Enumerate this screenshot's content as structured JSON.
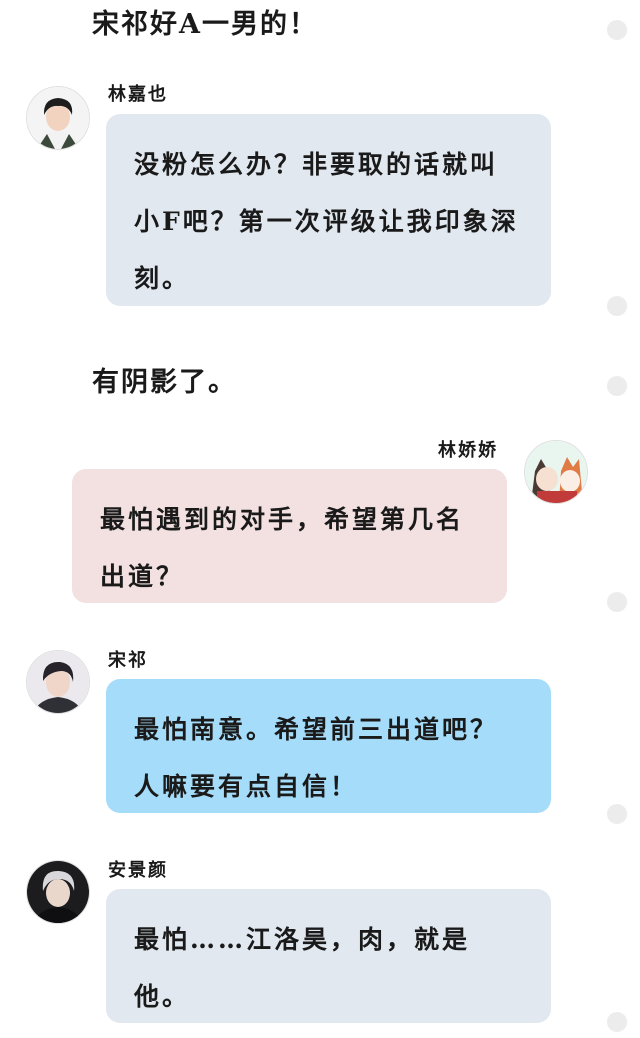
{
  "messages": [
    {
      "type": "narration",
      "text": "宋祁好A一男的！"
    },
    {
      "type": "chat",
      "side": "left",
      "sender": "林嘉也",
      "text": "没粉怎么办？非要取的话就叫小F吧？第一次评级让我印象深刻。",
      "avatar_icon": "avatar-boy-icon"
    },
    {
      "type": "narration",
      "text": "有阴影了。"
    },
    {
      "type": "chat",
      "side": "right",
      "sender": "林娇娇",
      "text": "最怕遇到的对手，希望第几名出道？",
      "avatar_icon": "avatar-cartoon-cats-icon"
    },
    {
      "type": "chat",
      "side": "left",
      "sender": "宋祁",
      "text": "最怕南意。希望前三出道吧？人嘛要有点自信！",
      "avatar_icon": "avatar-man-icon"
    },
    {
      "type": "chat",
      "side": "left",
      "sender": "安景颜",
      "text": "最怕……江洛昊，肉，就是他。",
      "avatar_icon": "avatar-silver-hair-icon"
    }
  ],
  "colors": {
    "bubble_grey": "#e1e8f0",
    "bubble_pink": "#f3e1e1",
    "bubble_blue": "#a5dcfa",
    "dot": "#ececec"
  }
}
